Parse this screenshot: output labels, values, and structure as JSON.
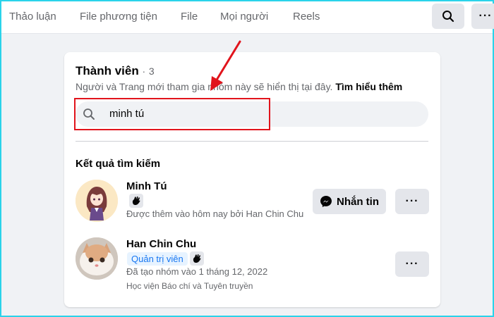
{
  "tabs": [
    {
      "label": "Thảo luận"
    },
    {
      "label": "File phương tiện"
    },
    {
      "label": "File"
    },
    {
      "label": "Mọi người"
    },
    {
      "label": "Reels"
    }
  ],
  "header_actions": {
    "search_icon": "search-icon",
    "more_label": "···"
  },
  "members_section": {
    "title": "Thành viên",
    "separator": "·",
    "count": "3",
    "description": "Người và Trang mới tham gia nhóm này sẽ hiển thị tại đây.",
    "learn_more": "Tìm hiểu thêm",
    "search_value": "minh tú"
  },
  "results": {
    "title": "Kết quả tìm kiếm",
    "members": [
      {
        "name": "Minh Tú",
        "meta": "Được thêm vào hôm nay bởi Han Chin Chu",
        "message_label": "Nhắn tin",
        "more_label": "···"
      },
      {
        "name": "Han Chin Chu",
        "badge": "Quản trị viên",
        "meta": "Đã tạo nhóm vào 1 tháng 12, 2022",
        "meta2": "Học viện Báo chí và Tuyên truyền",
        "more_label": "···"
      }
    ]
  },
  "colors": {
    "accent": "#1877f2",
    "highlight": "#e1141c",
    "border": "#2ad3ea",
    "background": "#f0f2f5"
  }
}
